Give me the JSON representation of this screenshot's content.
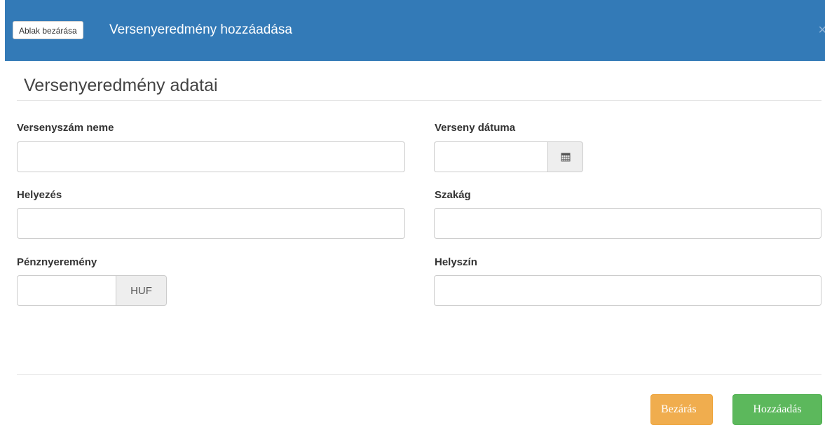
{
  "header": {
    "close_window_label": "Ablak bezárása",
    "title": "Versenyeredmény hozzáadása",
    "close_glyph": "×"
  },
  "section": {
    "title": "Versenyeredmény adatai"
  },
  "fields": {
    "event_name": {
      "label": "Versenyszám neme",
      "value": ""
    },
    "date": {
      "label": "Verseny dátuma",
      "value": "",
      "icon": "calendar-icon"
    },
    "placement": {
      "label": "Helyezés",
      "value": ""
    },
    "discipline": {
      "label": "Szakág",
      "value": ""
    },
    "prize": {
      "label": "Pénznyeremény",
      "value": "",
      "addon": "HUF"
    },
    "location": {
      "label": "Helyszín",
      "value": ""
    }
  },
  "footer": {
    "close_label": "Bezárás",
    "add_label": "Hozzáadás"
  },
  "colors": {
    "header_bg": "#337ab7",
    "close_btn": "#f0ad4e",
    "add_btn": "#5cb85c"
  }
}
